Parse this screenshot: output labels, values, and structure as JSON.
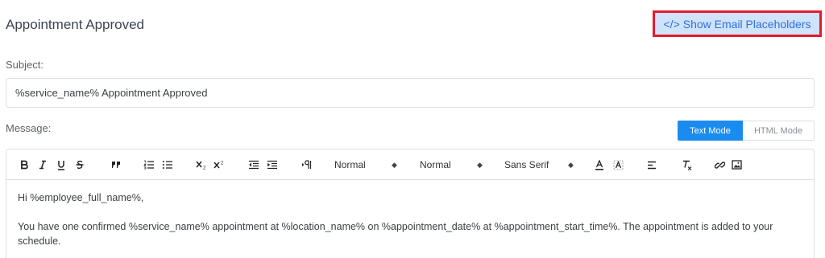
{
  "header": {
    "title": "Appointment Approved",
    "placeholders_icon": "</>",
    "placeholders_label": "Show Email Placeholders"
  },
  "subject": {
    "label": "Subject:",
    "value": "%service_name% Appointment Approved"
  },
  "message": {
    "label": "Message:",
    "modes": {
      "text": "Text Mode",
      "html": "HTML Mode",
      "active": "Text Mode"
    },
    "toolbar": {
      "header_select": "Normal",
      "size_select": "Normal",
      "font_select": "Sans Serif",
      "icons": [
        "bold-icon",
        "italic-icon",
        "underline-icon",
        "strike-icon",
        "blockquote-icon",
        "ordered-list-icon",
        "bullet-list-icon",
        "subscript-icon",
        "superscript-icon",
        "outdent-icon",
        "indent-icon",
        "text-direction-icon",
        "font-color-icon",
        "background-color-icon",
        "align-icon",
        "clear-format-icon",
        "link-icon",
        "image-icon"
      ]
    },
    "body": {
      "greeting": "Hi %employee_full_name%,",
      "paragraph": "You have one confirmed %service_name% appointment at %location_name% on %appointment_date% at %appointment_start_time%. The appointment is added to your schedule."
    }
  },
  "colors": {
    "accent": "#1a8cf0",
    "highlight_border": "#e8192c",
    "highlight_bg": "#cfe3fb",
    "link_text": "#2f6fde"
  }
}
